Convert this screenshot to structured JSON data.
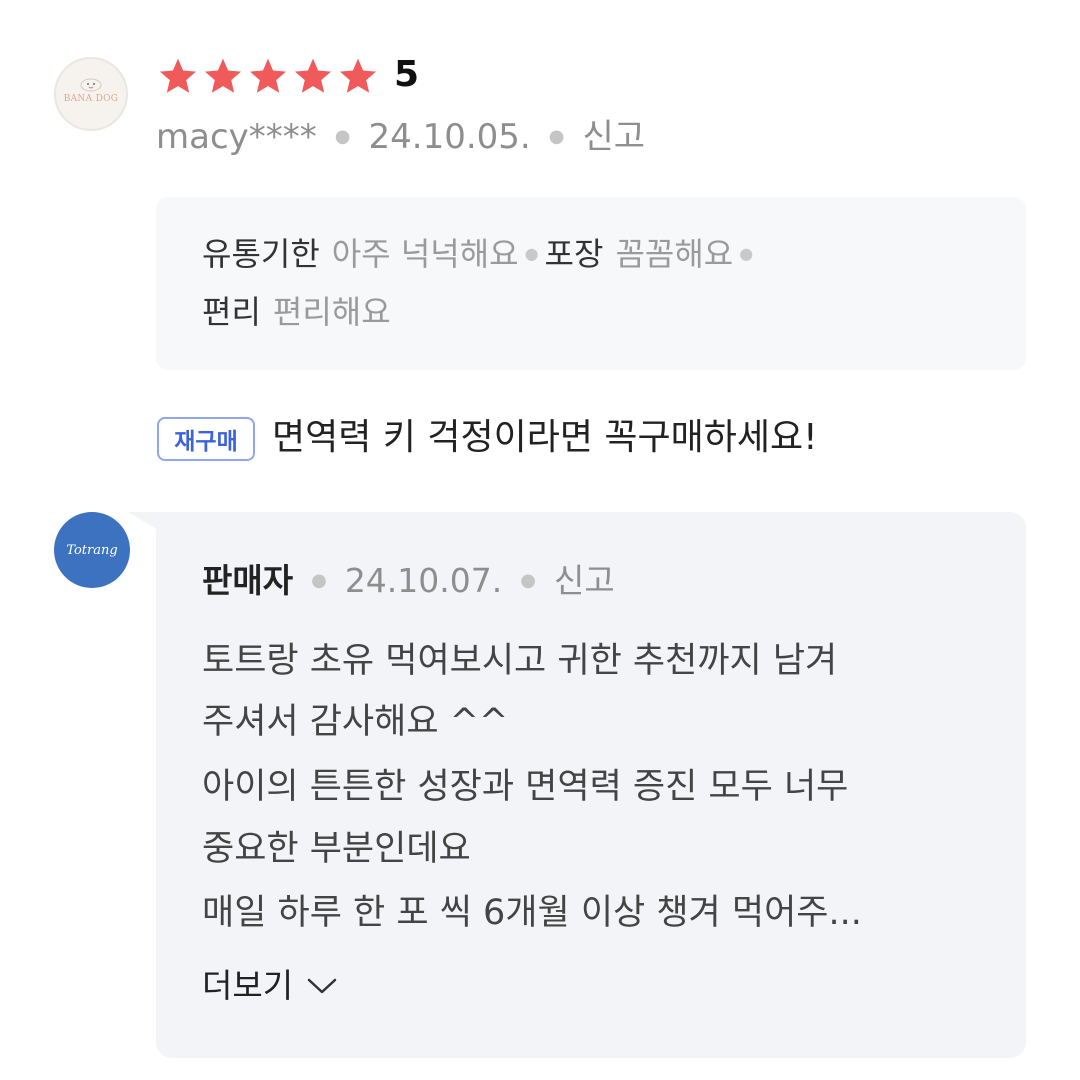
{
  "review": {
    "avatar_brand": "BANA DOG",
    "star_count": 5,
    "star_color": "#f05a5a",
    "score": "5",
    "username": "macy****",
    "date": "24.10.05.",
    "report_label": "신고",
    "attributes": [
      {
        "key": "유통기한",
        "value": "아주 넉넉해요"
      },
      {
        "key": "포장",
        "value": "꼼꼼해요"
      },
      {
        "key": "편리",
        "value": "편리해요"
      }
    ],
    "badge": "재구매",
    "text": "면역력 키 걱정이라면 꼭구매하세요!"
  },
  "seller_reply": {
    "avatar_brand": "Totrang",
    "name": "판매자",
    "date": "24.10.07.",
    "report_label": "신고",
    "lines": [
      "토트랑 초유 먹여보시고 귀한 추천까지 남겨",
      "주셔서 감사해요 ^^",
      "아이의 튼튼한 성장과 면역력 증진 모두 너무",
      "중요한 부분인데요",
      "매일 하루 한 포 씩 6개월 이상 챙겨 먹어주..."
    ],
    "more_label": "더보기",
    "more_icon": "chevron-down-icon"
  }
}
